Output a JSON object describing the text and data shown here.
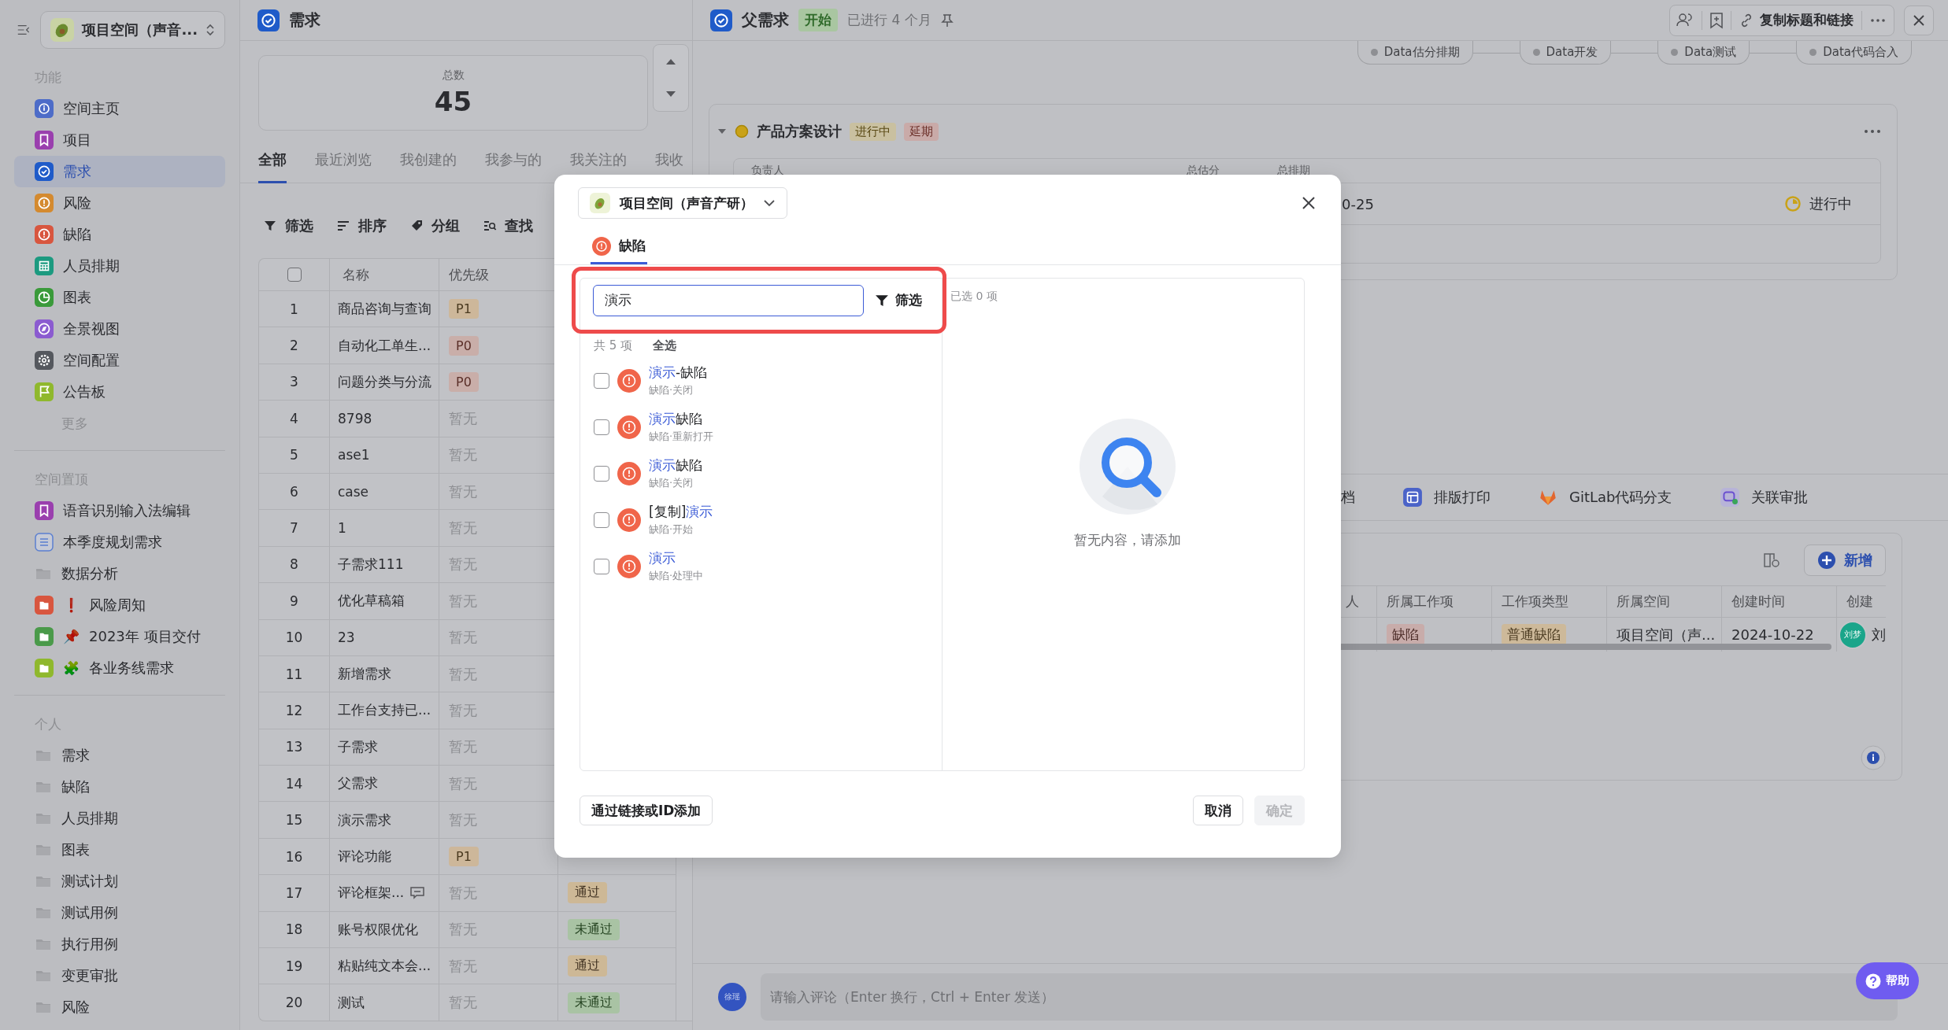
{
  "sidebar": {
    "space_switcher": "项目空间（声音...",
    "sections": [
      {
        "title": "功能",
        "more": "更多",
        "items": [
          {
            "label": "空间主页",
            "kind": "home",
            "color": "#4d6cc8",
            "selected": false
          },
          {
            "label": "项目",
            "kind": "project",
            "color": "#9a3fae",
            "selected": false
          },
          {
            "label": "需求",
            "kind": "requirement",
            "color": "#1f5bc9",
            "selected": true
          },
          {
            "label": "风险",
            "kind": "risk",
            "color": "#d48a2f",
            "selected": false
          },
          {
            "label": "缺陷",
            "kind": "defect",
            "color": "#d8563f",
            "selected": false
          },
          {
            "label": "人员排期",
            "kind": "schedule",
            "color": "#1c9a80",
            "selected": false
          },
          {
            "label": "图表",
            "kind": "chart",
            "color": "#3a9a3a",
            "selected": false
          },
          {
            "label": "全景视图",
            "kind": "overview",
            "color": "#8b5bd0",
            "selected": false
          },
          {
            "label": "空间配置",
            "kind": "settings",
            "color": "#55585e",
            "selected": false
          },
          {
            "label": "公告板",
            "kind": "board",
            "color": "#8fb82d",
            "selected": false
          }
        ]
      },
      {
        "title": "空间置顶",
        "items": [
          {
            "label": "语音识别输入法编辑",
            "kind": "project",
            "color": "#9a3fae",
            "selected": false
          },
          {
            "label": "本季度规划需求",
            "kind": "list",
            "color": "#5b7fd0",
            "selected": false
          },
          {
            "label": "数据分析",
            "kind": "folder",
            "selected": false
          },
          {
            "label": "风险周知",
            "kind": "tile-folder",
            "color": "#d8563f",
            "emoji": "❗",
            "selected": false
          },
          {
            "label": "2023年 项目交付",
            "kind": "tile-folder",
            "color": "#4a9a4a",
            "emoji": "📌",
            "selected": false
          },
          {
            "label": "各业务线需求",
            "kind": "tile-folder",
            "color": "#8fb82d",
            "emoji": "🧩",
            "selected": false
          }
        ]
      },
      {
        "title": "个人",
        "items": [
          {
            "label": "需求",
            "kind": "folder",
            "selected": false
          },
          {
            "label": "缺陷",
            "kind": "folder",
            "selected": false
          },
          {
            "label": "人员排期",
            "kind": "folder",
            "selected": false
          },
          {
            "label": "图表",
            "kind": "folder",
            "selected": false
          },
          {
            "label": "测试计划",
            "kind": "folder",
            "selected": false
          },
          {
            "label": "测试用例",
            "kind": "folder",
            "selected": false
          },
          {
            "label": "执行用例",
            "kind": "folder",
            "selected": false
          },
          {
            "label": "变更审批",
            "kind": "folder",
            "selected": false
          },
          {
            "label": "风险",
            "kind": "folder",
            "selected": false
          }
        ]
      }
    ]
  },
  "list_panel": {
    "title": "需求",
    "stats": {
      "label": "总数",
      "value": "45"
    },
    "tabs": [
      {
        "label": "全部",
        "selected": true
      },
      {
        "label": "最近浏览",
        "selected": false
      },
      {
        "label": "我创建的",
        "selected": false
      },
      {
        "label": "我参与的",
        "selected": false
      },
      {
        "label": "我关注的",
        "selected": false
      },
      {
        "label": "我收",
        "selected": false
      }
    ],
    "toolbar": [
      {
        "label": "筛选",
        "kind": "filter"
      },
      {
        "label": "排序",
        "kind": "sort"
      },
      {
        "label": "分组",
        "kind": "group"
      },
      {
        "label": "查找",
        "kind": "find"
      }
    ],
    "table": {
      "select_all_checked": false,
      "columns": [
        "名称",
        "优先级"
      ],
      "rows": [
        {
          "index": "1",
          "name": "商品咨询与查询",
          "priority": {
            "text": "P1",
            "kind": "p1"
          }
        },
        {
          "index": "2",
          "name": "自动化工单生...",
          "priority": {
            "text": "P0",
            "kind": "p0"
          }
        },
        {
          "index": "3",
          "name": "问题分类与分流",
          "priority": {
            "text": "P0",
            "kind": "p0"
          }
        },
        {
          "index": "4",
          "name": "8798",
          "priority": {
            "text": "暂无",
            "kind": "none"
          }
        },
        {
          "index": "5",
          "name": "ase1",
          "priority": {
            "text": "暂无",
            "kind": "none"
          }
        },
        {
          "index": "6",
          "name": "case",
          "priority": {
            "text": "暂无",
            "kind": "none"
          }
        },
        {
          "index": "7",
          "name": "1",
          "priority": {
            "text": "暂无",
            "kind": "none"
          }
        },
        {
          "index": "8",
          "name": "子需求111",
          "priority": {
            "text": "暂无",
            "kind": "none"
          }
        },
        {
          "index": "9",
          "name": "优化草稿箱",
          "priority": {
            "text": "暂无",
            "kind": "none"
          }
        },
        {
          "index": "10",
          "name": "23",
          "priority": {
            "text": "暂无",
            "kind": "none"
          }
        },
        {
          "index": "11",
          "name": "新增需求",
          "priority": {
            "text": "暂无",
            "kind": "none"
          }
        },
        {
          "index": "12",
          "name": "工作台支持已...",
          "priority": {
            "text": "暂无",
            "kind": "none"
          }
        },
        {
          "index": "13",
          "name": "子需求",
          "priority": {
            "text": "暂无",
            "kind": "none"
          }
        },
        {
          "index": "14",
          "name": "父需求",
          "priority": {
            "text": "暂无",
            "kind": "none"
          }
        },
        {
          "index": "15",
          "name": "演示需求",
          "priority": {
            "text": "暂无",
            "kind": "none"
          }
        },
        {
          "index": "16",
          "name": "评论功能",
          "priority": {
            "text": "P1",
            "kind": "p1"
          }
        },
        {
          "index": "17",
          "name": "评论框架...",
          "has_comment": true,
          "priority": {
            "text": "暂无",
            "kind": "none"
          },
          "review": {
            "text": "通过",
            "passed": true
          }
        },
        {
          "index": "18",
          "name": "账号权限优化",
          "priority": {
            "text": "暂无",
            "kind": "none"
          },
          "review": {
            "text": "未通过",
            "passed": false
          }
        },
        {
          "index": "19",
          "name": "粘贴纯文本会...",
          "priority": {
            "text": "暂无",
            "kind": "none"
          },
          "review": {
            "text": "通过",
            "passed": true
          }
        },
        {
          "index": "20",
          "name": "测试",
          "priority": {
            "text": "暂无",
            "kind": "none"
          },
          "review": {
            "text": "未通过",
            "passed": false
          }
        }
      ]
    }
  },
  "detail": {
    "title": "父需求",
    "status": "开始",
    "elapsed": "已进行 4 个月",
    "copy_link": "复制标题和链接",
    "pipeline": [
      "Data估分排期",
      "Data开发",
      "Data测试",
      "Data代码合入"
    ],
    "stage": {
      "title": "产品方案设计",
      "tags": [
        {
          "text": "进行中",
          "kind": "progress"
        },
        {
          "text": "延期",
          "kind": "delayed"
        }
      ],
      "columns": [
        "负责人",
        "总估分",
        "总排期"
      ],
      "date": "0-25",
      "state": "进行中"
    },
    "tabs": [
      {
        "label": "档",
        "kind": "doc"
      },
      {
        "label": "排版打印",
        "kind": "print"
      },
      {
        "label": "GitLab代码分支",
        "kind": "gitlab"
      },
      {
        "label": "关联审批",
        "kind": "approval"
      }
    ],
    "related": {
      "add": "新增",
      "columns": [
        "人",
        "所属工作项",
        "工作项类型",
        "所属空间",
        "创建时间",
        "创建"
      ],
      "rows": [
        {
          "item": "缺陷",
          "type": "普通缺陷",
          "space": "项目空间（声...",
          "created": "2024-10-22",
          "avatar": "刘梦",
          "creator": "刘"
        }
      ]
    },
    "comment": {
      "avatar": "徐瑶",
      "placeholder": "请输入评论（Enter 换行，Ctrl + Enter 发送）"
    },
    "help": "帮助"
  },
  "modal": {
    "space": "项目空间（声音产研）",
    "tabs": [
      {
        "label": "缺陷",
        "selected": true
      }
    ],
    "search": {
      "value": "演示",
      "highlighted": true
    },
    "filter": "筛选",
    "count": "共 5 项",
    "select_all": "全选",
    "results": [
      {
        "parts": [
          {
            "text": "演示",
            "match": true
          },
          {
            "text": "-缺陷",
            "match": false
          }
        ],
        "meta": "缺陷·关闭",
        "checked": false
      },
      {
        "parts": [
          {
            "text": "演示",
            "match": true
          },
          {
            "text": "缺陷",
            "match": false
          }
        ],
        "meta": "缺陷·重新打开",
        "checked": false
      },
      {
        "parts": [
          {
            "text": "演示",
            "match": true
          },
          {
            "text": "缺陷",
            "match": false
          }
        ],
        "meta": "缺陷·关闭",
        "checked": false
      },
      {
        "parts": [
          {
            "text": "[复制]",
            "match": false
          },
          {
            "text": "演示",
            "match": true
          }
        ],
        "meta": "缺陷·开始",
        "checked": false
      },
      {
        "parts": [
          {
            "text": "演示",
            "match": true
          }
        ],
        "meta": "缺陷·处理中",
        "checked": false
      }
    ],
    "selected_count": "已选 0 项",
    "empty": "暂无内容，请添加",
    "link_add": "通过链接或ID添加",
    "cancel": "取消",
    "confirm": {
      "label": "确定",
      "disabled": true
    }
  }
}
